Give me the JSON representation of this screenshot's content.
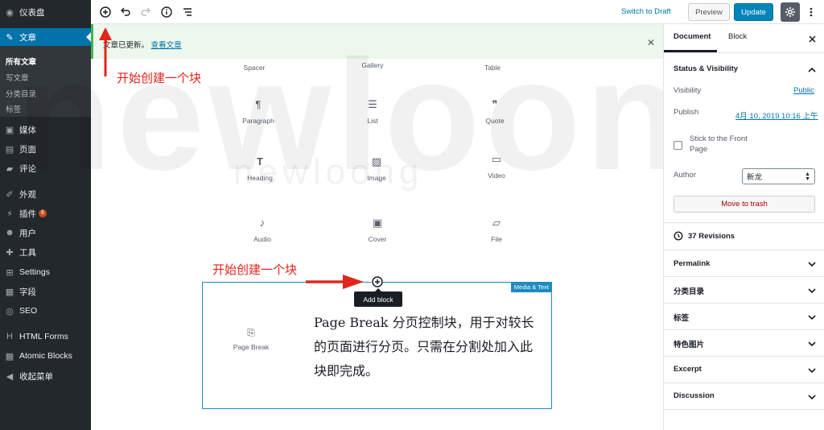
{
  "sidebar": {
    "dashboard": "仪表盘",
    "posts": "文章",
    "sub": [
      "所有文章",
      "写文章",
      "分类目录",
      "标签"
    ],
    "media": "媒体",
    "pages": "页面",
    "comments": "评论",
    "appearance": "外观",
    "plugins": "插件",
    "plugins_badge": "6",
    "users": "用户",
    "tools": "工具",
    "settings": "Settings",
    "fields": "字段",
    "seo": "SEO",
    "html_forms": "HTML Forms",
    "atomic_blocks": "Atomic Blocks",
    "collapse": "收起菜单"
  },
  "toolbar": {
    "switch_to_draft": "Switch to Draft",
    "preview": "Preview",
    "update": "Update"
  },
  "notice": {
    "text": "文章已更新。",
    "link": "查看文章"
  },
  "blocks": {
    "spacer": "Spacer",
    "gallery": "Gallery",
    "table": "Table",
    "paragraph": "Paragraph",
    "list": "List",
    "quote": "Quote",
    "heading": "Heading",
    "image": "Image",
    "video": "Video",
    "audio": "Audio",
    "cover": "Cover",
    "file": "File"
  },
  "annotations": {
    "top": "开始创建一个块",
    "middle": "开始创建一个块"
  },
  "media_text": {
    "tag": "Media & Text",
    "page_break": "Page Break",
    "body": "Page Break  分页控制块，用于对较长的页面进行分页。只需在分割处加入此块即完成。"
  },
  "tooltip": "Add block",
  "panel": {
    "tab_document": "Document",
    "tab_block": "Block",
    "status_title": "Status & Visibility",
    "visibility_label": "Visibility",
    "visibility_value": "Public",
    "publish_label": "Publish",
    "publish_value": "4月 10, 2019 10:16 上午",
    "stick_label": "Stick to the Front Page",
    "author_label": "Author",
    "author_value": "新龙",
    "trash": "Move to trash",
    "revisions": "37 Revisions",
    "sections": [
      "Permalink",
      "分类目录",
      "标签",
      "特色图片",
      "Excerpt",
      "Discussion"
    ]
  },
  "watermark": {
    "big": "newloong",
    "small": "newloong"
  },
  "colors": {
    "accent": "#0073aa",
    "sidebar": "#23282d",
    "annotation": "#e0261b",
    "notice_border": "#46b450"
  }
}
